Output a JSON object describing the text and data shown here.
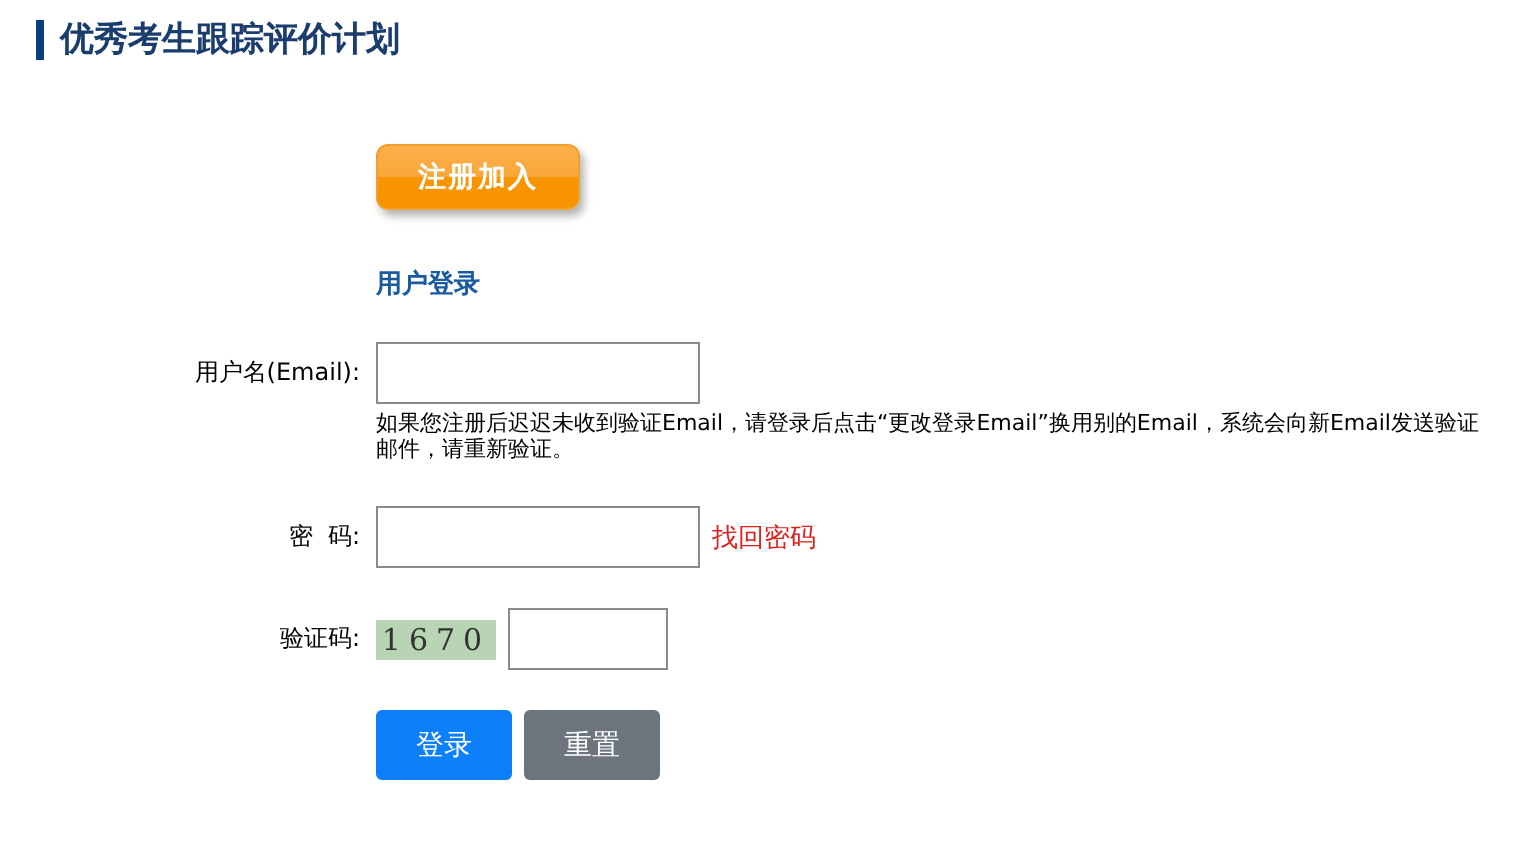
{
  "title": "优秀考生跟踪评价计划",
  "register_button": "注册加入",
  "login_heading": "用户登录",
  "username": {
    "label": "用户名(Email):",
    "help": "如果您注册后迟迟未收到验证Email，请登录后点击“更改登录Email”换用别的Email，系统会向新Email发送验证邮件，请重新验证。"
  },
  "password": {
    "label": "密  码:",
    "link": "找回密码"
  },
  "captcha": {
    "label": "验证码:",
    "code": "1670"
  },
  "buttons": [
    {
      "label": "登录",
      "kind": "primary"
    },
    {
      "label": "重置",
      "kind": "secondary"
    }
  ]
}
